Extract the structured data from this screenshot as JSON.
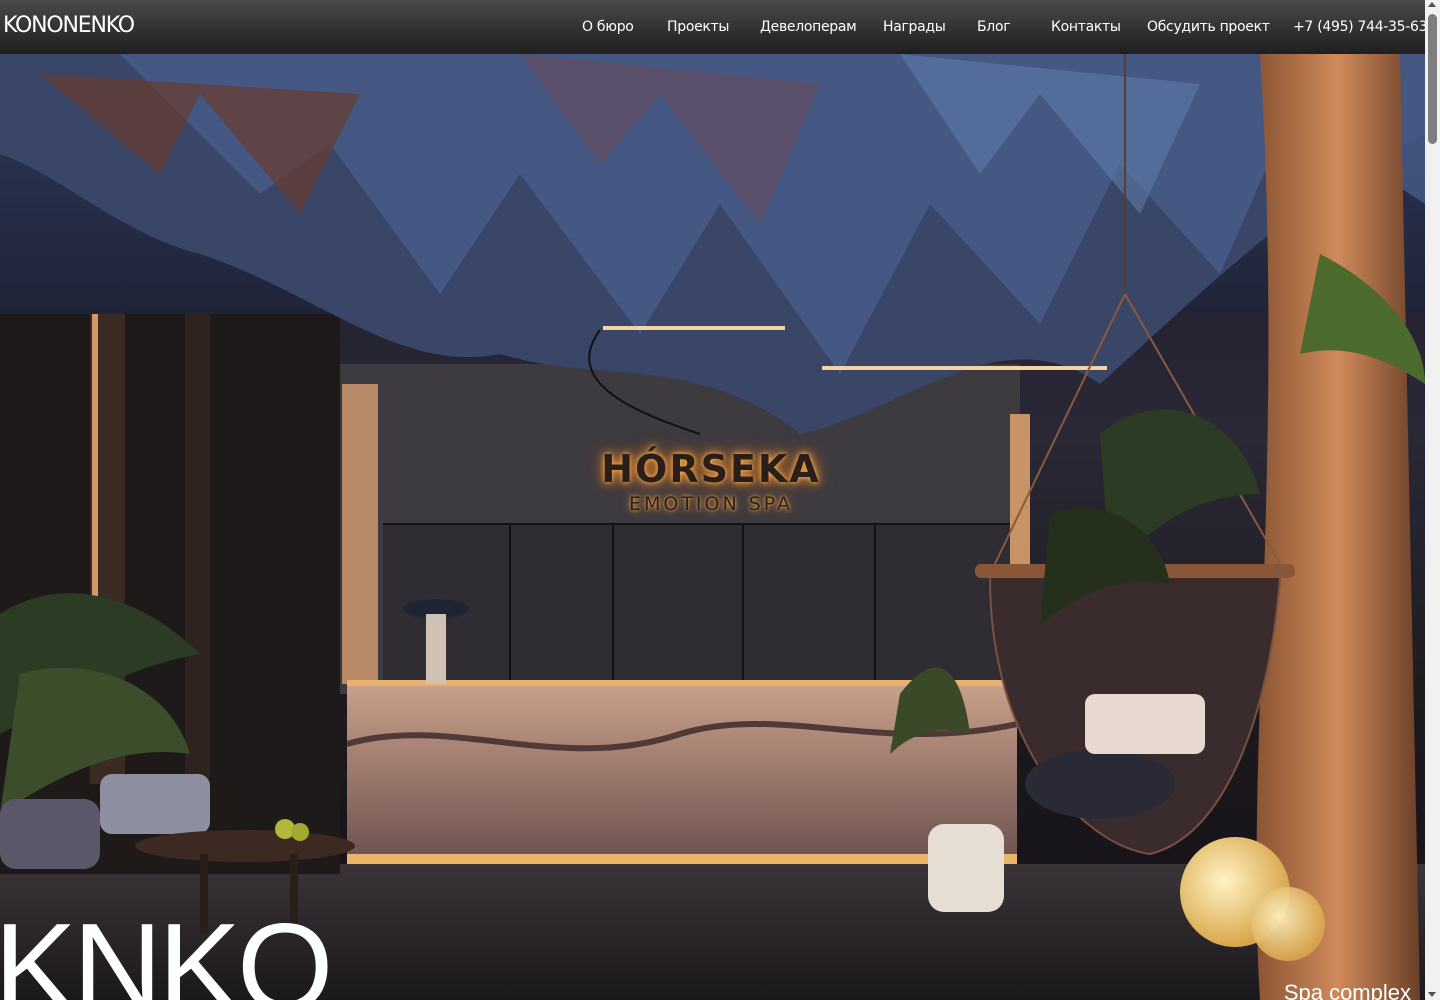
{
  "header": {
    "logo": "KONONENKO",
    "nav": [
      {
        "label": "О бюро"
      },
      {
        "label": "Проекты"
      },
      {
        "label": "Девелоперам"
      },
      {
        "label": "Награды"
      },
      {
        "label": "Блог"
      },
      {
        "label": "Контакты"
      },
      {
        "label": "Обсудить проект"
      },
      {
        "label": "+7 (495) 744-35-63"
      }
    ]
  },
  "hero": {
    "sign_brand": "HÓRSEKA",
    "sign_subtitle": "EMOTION SPA",
    "big_title": "KNKO",
    "caption": "Spa complex"
  },
  "colors": {
    "header_top": "#4a4a4a",
    "header_bottom": "#1f1f1f",
    "sign_glow": "#e58d32",
    "text": "#ffffff"
  }
}
